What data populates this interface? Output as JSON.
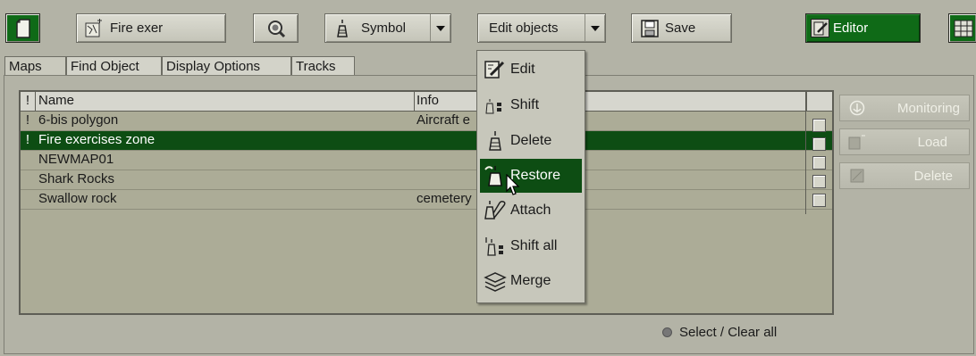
{
  "toolbar": {
    "new_icon": "new-document-icon",
    "map_button_label": "Fire exer",
    "find_icon": "magnifier-icon",
    "symbol_label": "Symbol",
    "edit_objects_label": "Edit objects",
    "save_label": "Save",
    "editor_label": "Editor"
  },
  "tabs": [
    {
      "label": "Maps",
      "active": true
    },
    {
      "label": "Find Object",
      "active": false
    },
    {
      "label": "Display Options",
      "active": false
    },
    {
      "label": "Tracks",
      "active": false
    }
  ],
  "table": {
    "columns": [
      "!",
      "Name",
      "Info"
    ],
    "rows": [
      {
        "flag": "!",
        "name": "6-bis polygon",
        "info": "Aircraft e",
        "selected": false
      },
      {
        "flag": "!",
        "name": "Fire exercises zone",
        "info": "",
        "selected": true
      },
      {
        "flag": "",
        "name": "NEWMAP01",
        "info": "",
        "selected": false
      },
      {
        "flag": "",
        "name": "Shark Rocks",
        "info": "",
        "selected": false
      },
      {
        "flag": "",
        "name": "Swallow rock",
        "info": "cemetery",
        "selected": false
      }
    ]
  },
  "side_buttons": [
    {
      "label": "Monitoring",
      "icon": "anchor-icon"
    },
    {
      "label": "Load",
      "icon": "load-map-icon"
    },
    {
      "label": "Delete",
      "icon": "delete-map-icon"
    }
  ],
  "select_clear_label": "Select / Clear all",
  "edit_menu": {
    "items": [
      {
        "label": "Edit",
        "icon": "edit-icon",
        "highlighted": false
      },
      {
        "label": "Shift",
        "icon": "shift-icon",
        "highlighted": false
      },
      {
        "label": "Delete",
        "icon": "delete-buoy-icon",
        "highlighted": false
      },
      {
        "label": "Restore",
        "icon": "restore-icon",
        "highlighted": true
      },
      {
        "label": "Attach",
        "icon": "attach-icon",
        "highlighted": false
      },
      {
        "label": "Shift all",
        "icon": "shift-all-icon",
        "highlighted": false
      },
      {
        "label": "Merge",
        "icon": "merge-icon",
        "highlighted": false
      }
    ]
  },
  "colors": {
    "selection": "#0d4d13",
    "editor_active": "#0f6a17",
    "background": "#b3b3a6"
  }
}
